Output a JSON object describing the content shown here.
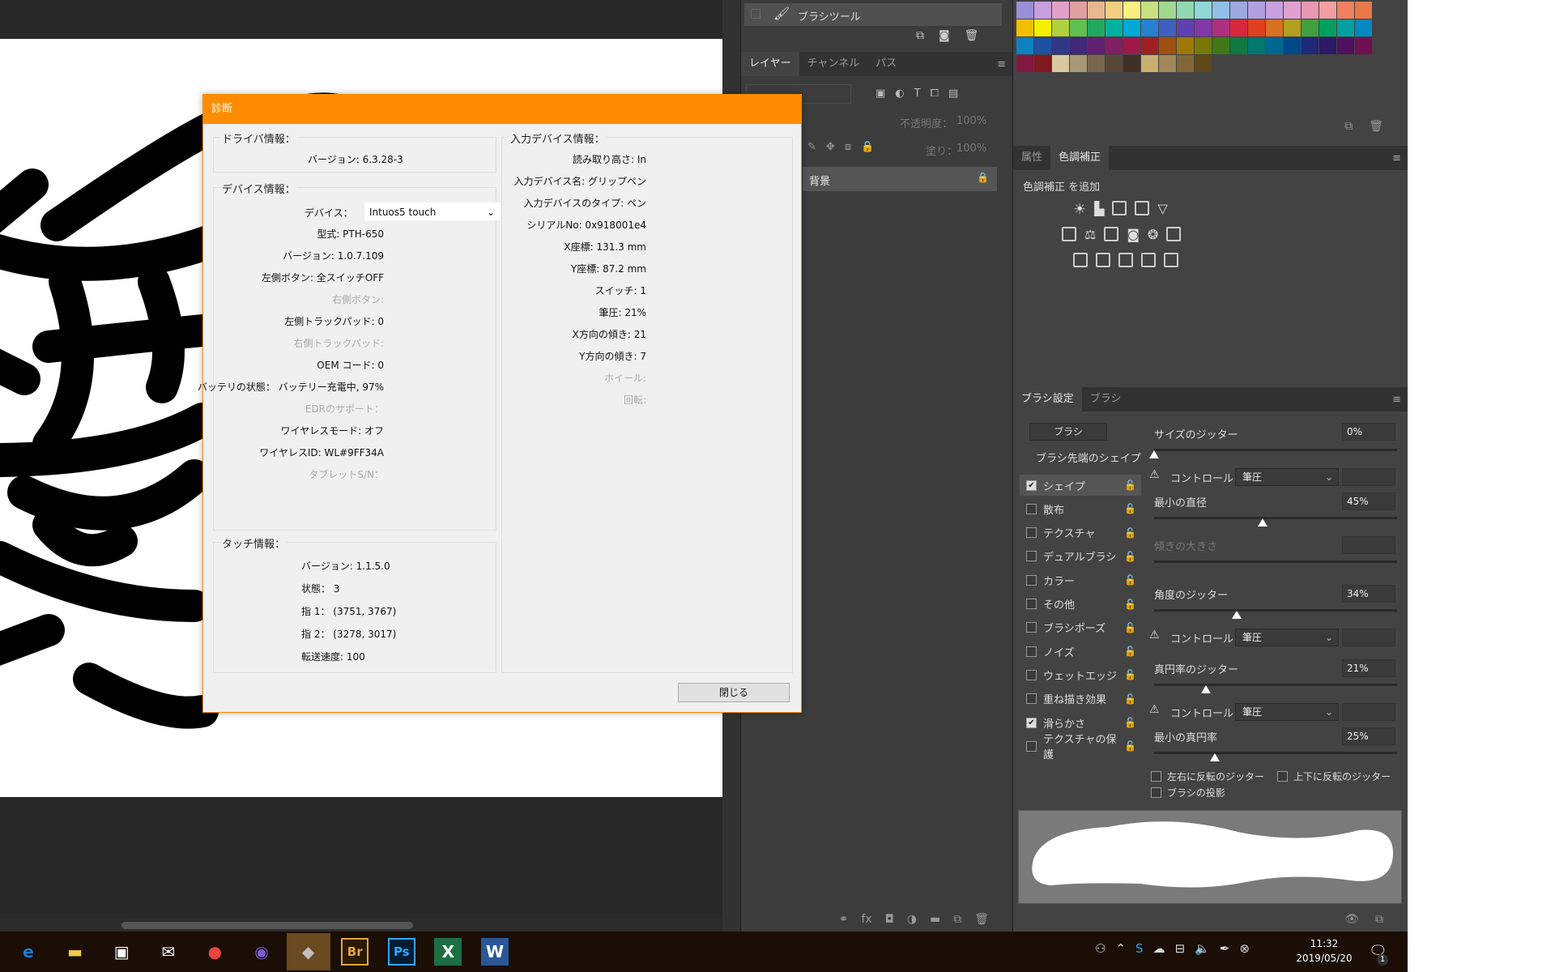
{
  "history": {
    "item_label": "ブラシツール"
  },
  "layers": {
    "tabs": [
      "レイヤー",
      "チャンネル",
      "パス"
    ],
    "opacity_label": "不透明度：",
    "opacity_value": "100%",
    "fill_label": "塗り：",
    "fill_value": "100%",
    "background_layer": "背景"
  },
  "adjustments": {
    "tabs": [
      "属性",
      "色調補正"
    ],
    "add_label": "色調補正 を追加"
  },
  "brush": {
    "tabs": [
      "ブラシ設定",
      "ブラシ"
    ],
    "brush_button": "ブラシ",
    "tip_shape": "ブラシ先端のシェイプ",
    "items": [
      {
        "label": "シェイプ",
        "checked": true
      },
      {
        "label": "散布",
        "checked": false
      },
      {
        "label": "テクスチャ",
        "checked": false
      },
      {
        "label": "デュアルブラシ",
        "checked": false
      },
      {
        "label": "カラー",
        "checked": false
      },
      {
        "label": "その他",
        "checked": false
      },
      {
        "label": "ブラシポーズ",
        "checked": false
      },
      {
        "label": "ノイズ",
        "checked": false
      },
      {
        "label": "ウェットエッジ",
        "checked": false
      },
      {
        "label": "重ね描き効果",
        "checked": false
      },
      {
        "label": "滑らかさ",
        "checked": true
      },
      {
        "label": "テクスチャの保護",
        "checked": false
      }
    ],
    "size_jitter_label": "サイズのジッター",
    "size_jitter_value": "0%",
    "control_label": "コントロール：",
    "control_value": "筆圧",
    "min_diameter_label": "最小の直径",
    "min_diameter_value": "45%",
    "tilt_scale_label": "傾きの大きさ",
    "angle_jitter_label": "角度のジッター",
    "angle_jitter_value": "34%",
    "roundness_jitter_label": "真円率のジッター",
    "roundness_jitter_value": "21%",
    "min_roundness_label": "最小の真円率",
    "min_roundness_value": "25%",
    "flip_x_label": "左右に反転のジッター",
    "flip_y_label": "上下に反転のジッター",
    "projection_label": "ブラシの投影"
  },
  "dialog": {
    "title": "診断",
    "driver_group": "ドライバ情報：",
    "driver_version": "バージョン: 6.3.28-3",
    "device_group": "デバイス情報：",
    "device_label": "デバイス：",
    "device_value": "Intuos5 touch",
    "device_fields": [
      {
        "text": "型式: PTH-650",
        "dim": false
      },
      {
        "text": "バージョン: 1.0.7.109",
        "dim": false
      },
      {
        "text": "左側ボタン: 全スイッチOFF",
        "dim": false
      },
      {
        "text": "右側ボタン:",
        "dim": true
      },
      {
        "text": "左側トラックパッド: 0",
        "dim": false
      },
      {
        "text": "右側トラックパッド:",
        "dim": true
      },
      {
        "text": "OEM コード: 0",
        "dim": false
      },
      {
        "text": "バッテリの状態： バッテリー充電中, 97%",
        "dim": false
      },
      {
        "text": "EDRのサポート：",
        "dim": true
      },
      {
        "text": "ワイヤレスモード: オフ",
        "dim": false
      },
      {
        "text": "ワイヤレスID: WL#9FF34A",
        "dim": false
      },
      {
        "text": "タブレットS/N：",
        "dim": true
      }
    ],
    "touch_group": "タッチ情報：",
    "touch_fields": [
      "バージョン: 1.1.5.0",
      "状態： 3",
      "指 1： (3751, 3767)",
      "指 2： (3278, 3017)",
      "転送速度: 100"
    ],
    "input_group": "入力デバイス情報：",
    "input_fields": [
      {
        "text": "読み取り高さ: In",
        "dim": false
      },
      {
        "text": "入力デバイス名: グリップペン",
        "dim": false
      },
      {
        "text": "入力デバイスのタイプ: ペン",
        "dim": false
      },
      {
        "text": "シリアルNo: 0x918001e4",
        "dim": false
      },
      {
        "text": "X座標: 131.3 mm",
        "dim": false
      },
      {
        "text": "Y座標: 87.2 mm",
        "dim": false
      },
      {
        "text": "スイッチ: 1",
        "dim": false
      },
      {
        "text": "筆圧: 21%",
        "dim": false
      },
      {
        "text": "X方向の傾き: 21",
        "dim": false
      },
      {
        "text": "Y方向の傾き: 7",
        "dim": false
      },
      {
        "text": "ホイール:",
        "dim": true
      },
      {
        "text": "回転:",
        "dim": true
      }
    ],
    "close_button": "閉じる"
  },
  "taskbar": {
    "time": "11:32",
    "date": "2019/05/20",
    "notification_count": "1",
    "apps": [
      {
        "name": "edge-icon",
        "glyph": "e",
        "color": "#1e7bd8"
      },
      {
        "name": "file-explorer-icon",
        "glyph": "▬",
        "color": "#f2c94c"
      },
      {
        "name": "store-icon",
        "glyph": "▣",
        "color": "#ffffff"
      },
      {
        "name": "mail-icon",
        "glyph": "✉",
        "color": "#ffffff"
      },
      {
        "name": "chrome-icon",
        "glyph": "●",
        "color": "#e8453c"
      },
      {
        "name": "media-player-icon",
        "glyph": "◉",
        "color": "#7a5cd6"
      },
      {
        "name": "wacom-icon",
        "glyph": "◆",
        "color": "#c0c0c0"
      },
      {
        "name": "bridge-icon",
        "glyph": "Br",
        "color": "#e8a33c"
      },
      {
        "name": "photoshop-icon",
        "glyph": "Ps",
        "color": "#31a8ff"
      },
      {
        "name": "excel-icon",
        "glyph": "X",
        "color": "#ffffff"
      },
      {
        "name": "word-icon",
        "glyph": "W",
        "color": "#ffffff"
      }
    ]
  },
  "colors": {
    "dialog_accent": "#ff8c00",
    "panel_bg": "#434343",
    "taskbar_bg": "#1a0e06"
  },
  "swatches": [
    "#9a8fd6",
    "#c6a0dc",
    "#e0a0c8",
    "#e0a0a0",
    "#e8b890",
    "#f0d080",
    "#f8f080",
    "#c8e080",
    "#a0d890",
    "#90d8b0",
    "#90d8d8",
    "#90c0e8",
    "#a0a8e0",
    "#b0a0e0",
    "#c8a0e0",
    "#e0a0d0",
    "#e898b0",
    "#f0a0a0",
    "#f08060",
    "#e87848",
    "#00000000",
    "#f0c000",
    "#f8f000",
    "#b0d040",
    "#60c050",
    "#20a860",
    "#00b0a0",
    "#00a8d8",
    "#2880d0",
    "#4060c0",
    "#6040b0",
    "#8038a8",
    "#b03080",
    "#d82840",
    "#e04020",
    "#d87020",
    "#b0a020",
    "#40a040",
    "#00a060",
    "#00a0a0",
    "#0088c0",
    "#00000000",
    "#1080c0",
    "#2050a0",
    "#303888",
    "#402878",
    "#602070",
    "#802060",
    "#a01848",
    "#a02020",
    "#a05010",
    "#a07808",
    "#787808",
    "#407818",
    "#107840",
    "#007870",
    "#006890",
    "#004888",
    "#202878",
    "#301868",
    "#501060",
    "#701050",
    "#00000000",
    "#801840",
    "#801820",
    "#d8c8a0",
    "#a89878",
    "#786850",
    "#584838",
    "#403028",
    "#c8b070",
    "#a08858",
    "#806838",
    "#604818",
    "#00000000"
  ]
}
